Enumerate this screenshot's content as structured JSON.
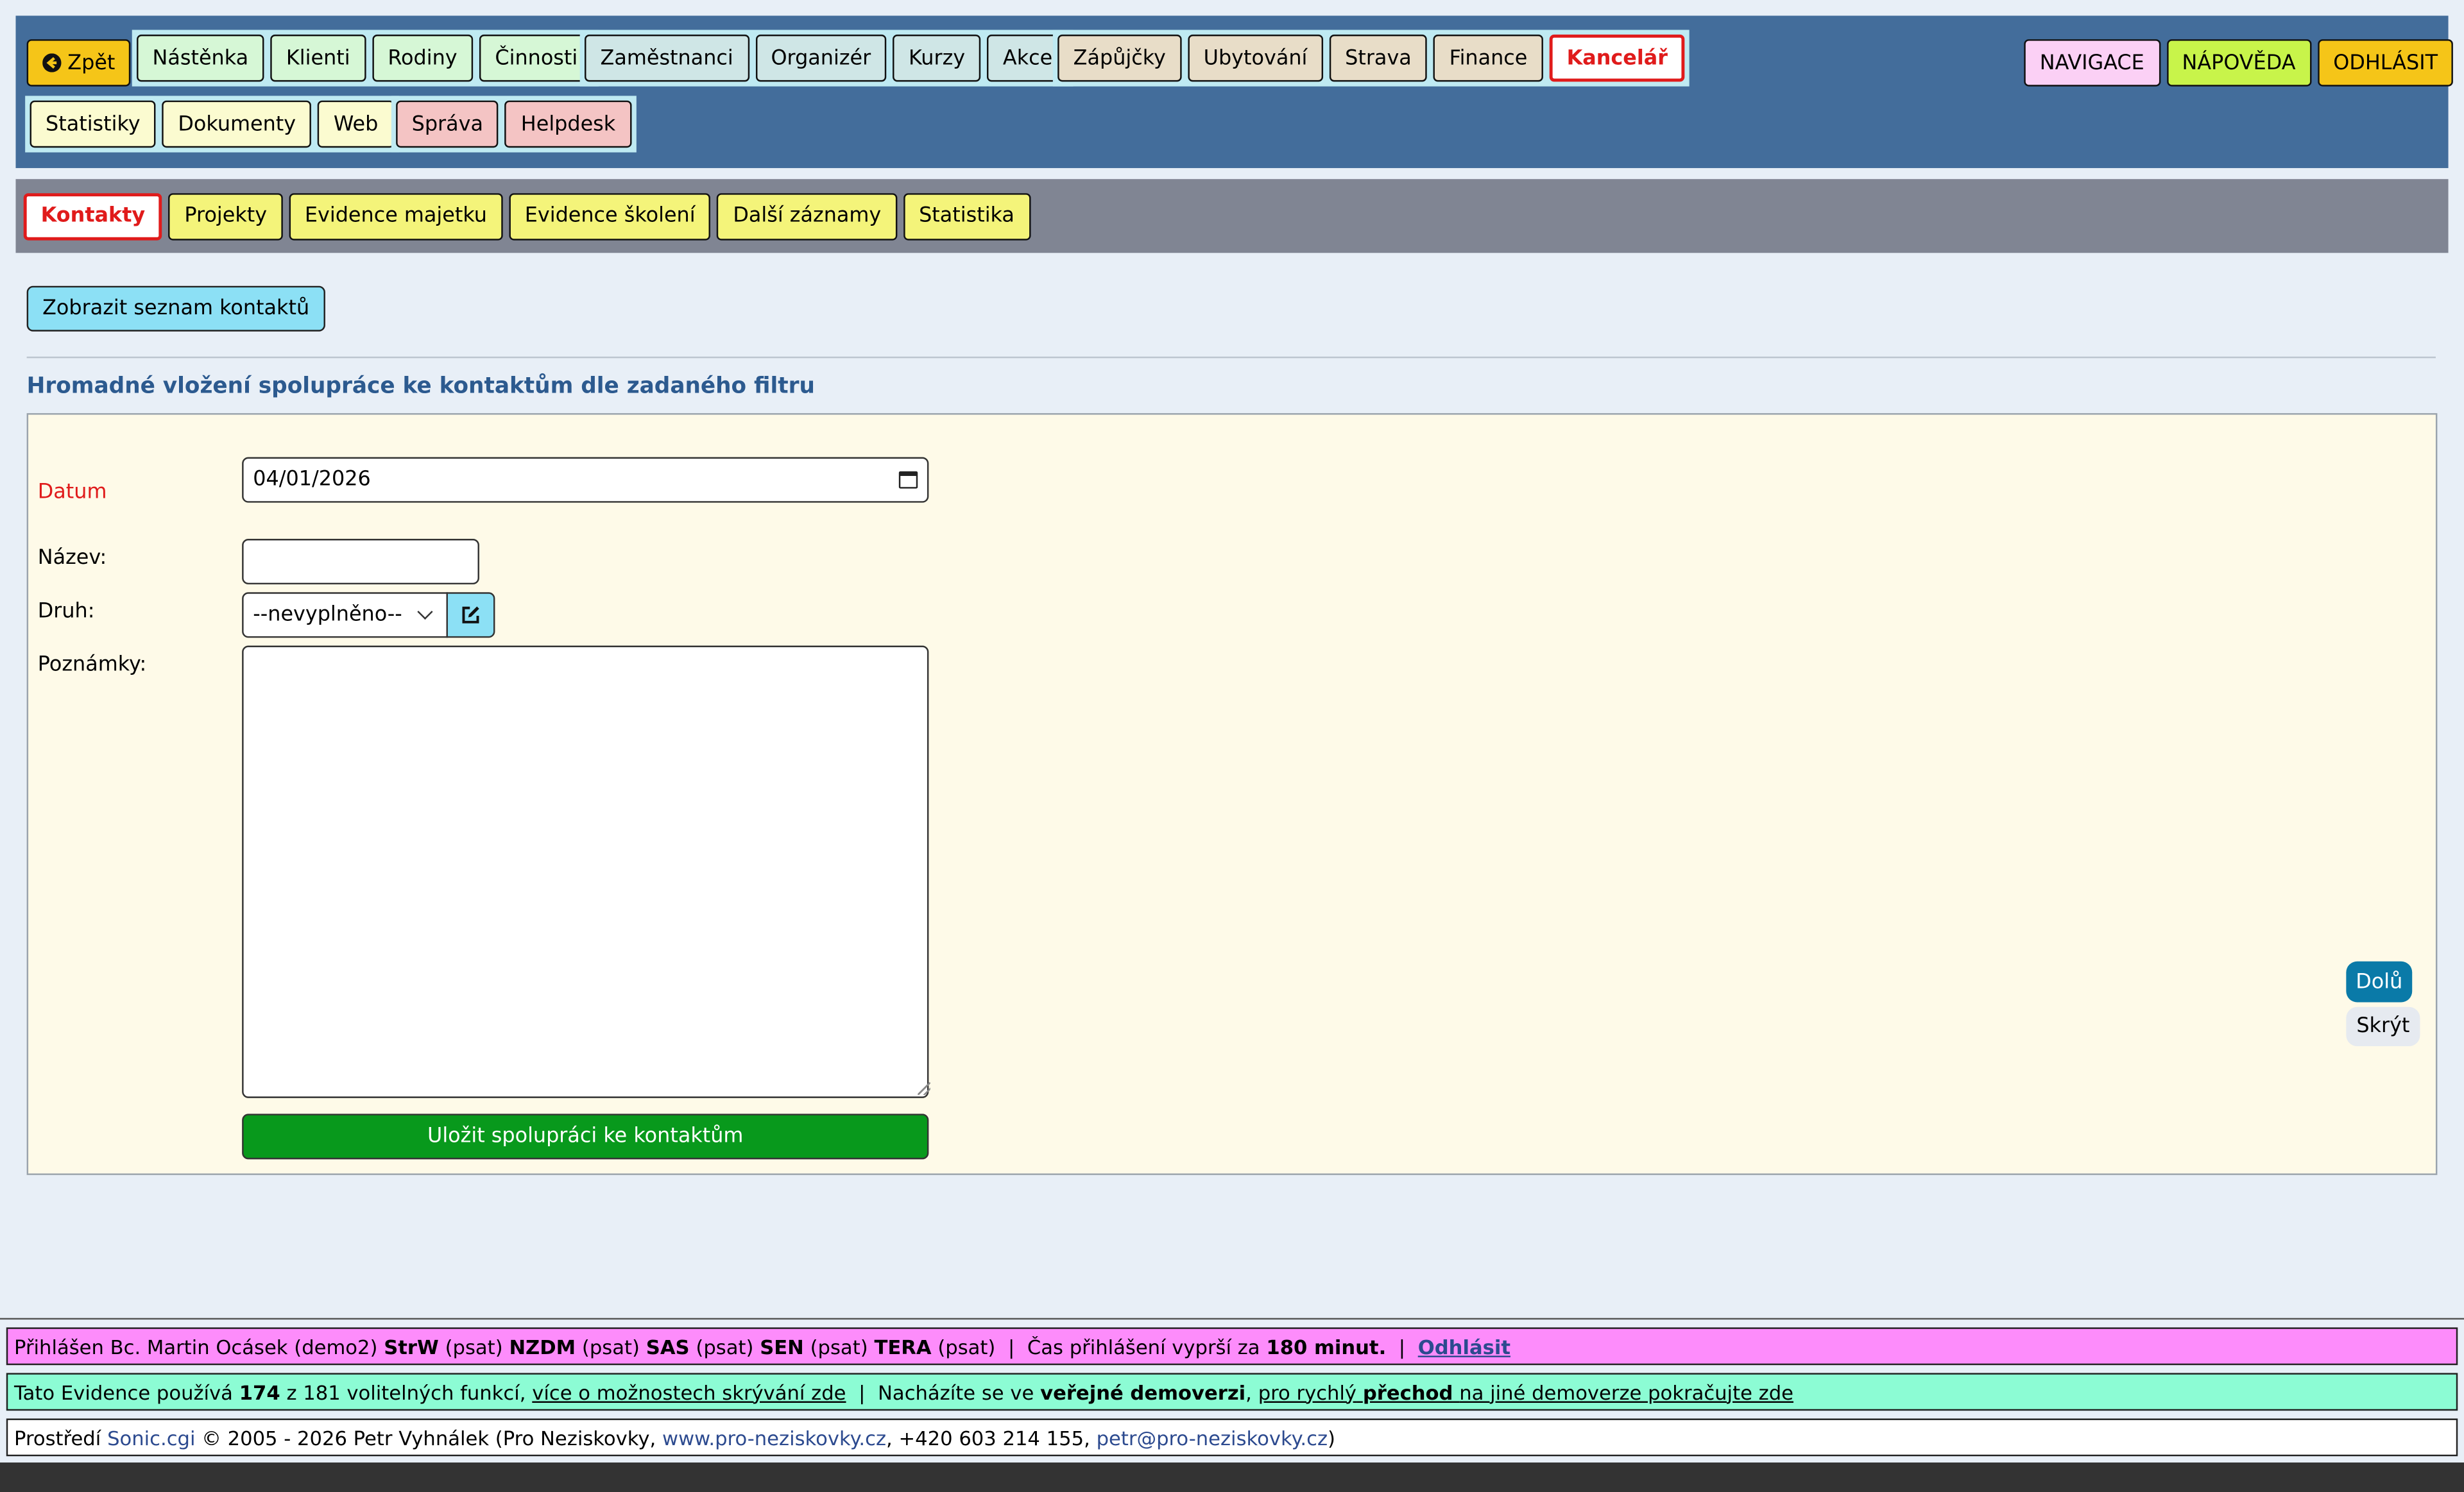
{
  "topnav": {
    "back": "Zpět",
    "group1": [
      "Nástěnka",
      "Klienti",
      "Rodiny",
      "Činnosti"
    ],
    "group2": [
      "Zaměstnanci",
      "Organizér",
      "Kurzy",
      "Akce"
    ],
    "group3": [
      "Zápůjčky",
      "Ubytování",
      "Strava",
      "Finance"
    ],
    "active": "Kancelář",
    "row2a": [
      "Statistiky",
      "Dokumenty",
      "Web"
    ],
    "row2b": [
      "Správa",
      "Helpdesk"
    ],
    "right": [
      "NAVIGACE",
      "NÁPOVĚDA",
      "ODHLÁSIT"
    ]
  },
  "subnav": {
    "active": "Kontakty",
    "items": [
      "Projekty",
      "Evidence majetku",
      "Evidence školení",
      "Další záznamy",
      "Statistika"
    ]
  },
  "main": {
    "show_list": "Zobrazit seznam kontaktů",
    "heading": "Hromadné vložení spolupráce ke kontaktům dle zadaného filtru",
    "form": {
      "date_label": "Datum",
      "date_value": "04/01/2026",
      "name_label": "Název:",
      "name_value": "",
      "type_label": "Druh:",
      "type_value": "--nevyplněno--",
      "notes_label": "Poznámky:",
      "notes_value": "",
      "save": "Uložit spolupráci ke kontaktům"
    },
    "scroll_down": "Dolů",
    "hide": "Skrýt"
  },
  "footer": {
    "line1": {
      "logged_prefix": "Přihlášen Bc. Martin Ocásek (demo2)",
      "roles": [
        {
          "code": "StrW",
          "perm": "(psat)"
        },
        {
          "code": "NZDM",
          "perm": "(psat)"
        },
        {
          "code": "SAS",
          "perm": "(psat)"
        },
        {
          "code": "SEN",
          "perm": "(psat)"
        },
        {
          "code": "TERA",
          "perm": "(psat)"
        }
      ],
      "expire_text": "Čas přihlášení vyprší za",
      "expire_value": "180 minut.",
      "logout": "Odhlásit"
    },
    "line2": {
      "t1": "Tato Evidence používá",
      "used": "174",
      "t2": "z 181 volitelných funkcí,",
      "link1": "více o možnostech skrývání zde",
      "t3": "Nacházíte se ve",
      "demo": "veřejné demoverzi",
      "link2a": "pro rychlý",
      "link2b": "přechod",
      "link2c": "na jiné demoverze pokračujte zde"
    },
    "line3": {
      "t1": "Prostředí",
      "sonic": "Sonic.cgi",
      "t2": "© 2005 - 2026 Petr Vyhnálek (Pro Neziskovky,",
      "web": "www.pro-neziskovky.cz",
      "t3": ", +420 603 214 155,",
      "email": "petr@pro-neziskovky.cz",
      "t4": ")"
    }
  },
  "colors": {
    "topnav_bg": "#436d9b",
    "subnav_bg": "#808593",
    "active_red": "#e01b1b",
    "save_green": "#08991c"
  }
}
